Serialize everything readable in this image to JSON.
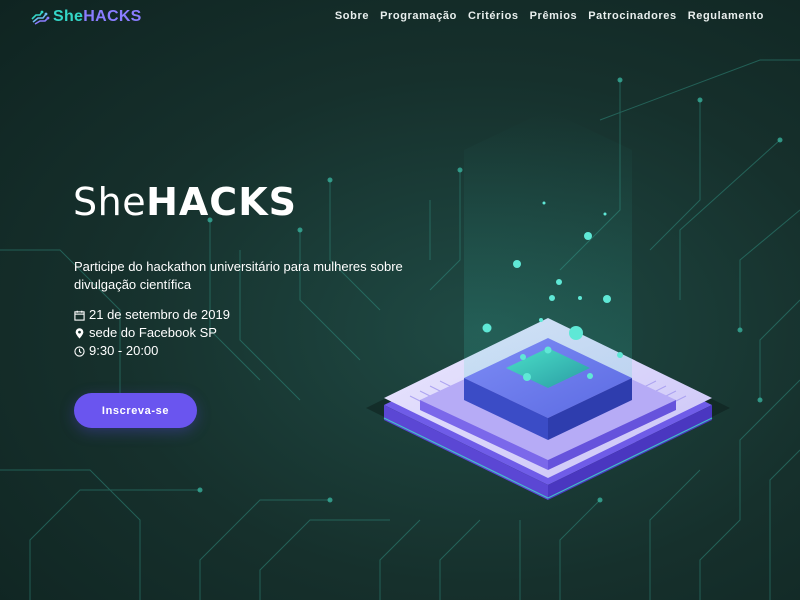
{
  "brand": {
    "logo_she": "She",
    "logo_hacks": "HACKS",
    "colors": {
      "teal": "#34d6c7",
      "purple": "#8a7dff",
      "button": "#6a55ef",
      "background": "#17302d"
    }
  },
  "nav": {
    "items": [
      {
        "label": "Sobre"
      },
      {
        "label": "Programação"
      },
      {
        "label": "Critérios"
      },
      {
        "label": "Prêmios"
      },
      {
        "label": "Patrocinadores"
      },
      {
        "label": "Regulamento"
      }
    ]
  },
  "hero": {
    "title_she": "She",
    "title_hacks": "HACKS",
    "tagline": "Participe do hackathon universitário para mulheres sobre divulgação científica",
    "details": {
      "date": "21 de setembro de 2019",
      "date_icon": "calendar-icon",
      "location": "sede do Facebook SP",
      "location_icon": "map-pin-icon",
      "time": "9:30 - 20:00",
      "time_icon": "clock-icon"
    },
    "cta_label": "Inscreva-se"
  }
}
